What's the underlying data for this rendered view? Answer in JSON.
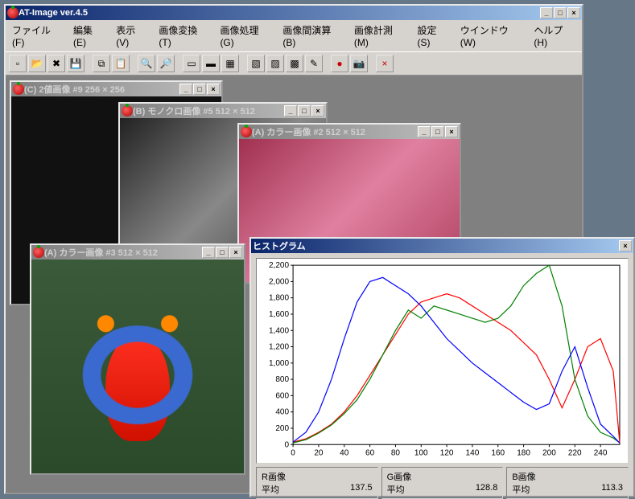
{
  "app": {
    "title": "AT-Image ver.4.5",
    "menu": [
      {
        "label": "ファイル(F)"
      },
      {
        "label": "編集(E)"
      },
      {
        "label": "表示(V)"
      },
      {
        "label": "画像変換(T)"
      },
      {
        "label": "画像処理(G)"
      },
      {
        "label": "画像間演算(B)"
      },
      {
        "label": "画像計測(M)"
      },
      {
        "label": "設定(S)"
      },
      {
        "label": "ウインドウ(W)"
      },
      {
        "label": "ヘルプ(H)"
      }
    ]
  },
  "child_windows": {
    "c": {
      "title": "(C) 2値画像 #9  256 × 256"
    },
    "b": {
      "title": "(B) モノクロ画像 #5  512 × 512"
    },
    "a2": {
      "title": "(A) カラー画像 #2  512 × 512"
    },
    "a3": {
      "title": "(A) カラー画像 #3  512 × 512"
    }
  },
  "histogram": {
    "title": "ヒストグラム",
    "stats": {
      "r": {
        "label": "R画像",
        "mean_label": "平均",
        "mean": "137.5"
      },
      "g": {
        "label": "G画像",
        "mean_label": "平均",
        "mean": "128.8"
      },
      "b": {
        "label": "B画像",
        "mean_label": "平均",
        "mean": "113.3"
      }
    }
  },
  "chart_data": {
    "type": "line",
    "title": "",
    "xlabel": "",
    "ylabel": "",
    "xlim": [
      0,
      255
    ],
    "ylim": [
      0,
      2200
    ],
    "x_ticks": [
      0,
      20,
      40,
      60,
      80,
      100,
      120,
      140,
      160,
      180,
      200,
      220,
      240
    ],
    "y_ticks": [
      0,
      200,
      400,
      600,
      800,
      1000,
      1200,
      1400,
      1600,
      1800,
      2000,
      2200
    ],
    "series": [
      {
        "name": "R",
        "color": "#ff0000",
        "x": [
          0,
          10,
          20,
          30,
          40,
          50,
          60,
          70,
          80,
          90,
          100,
          110,
          120,
          130,
          140,
          150,
          160,
          170,
          180,
          190,
          200,
          210,
          220,
          230,
          240,
          250,
          255
        ],
        "values": [
          30,
          70,
          150,
          250,
          400,
          600,
          850,
          1100,
          1350,
          1600,
          1750,
          1800,
          1850,
          1800,
          1700,
          1600,
          1500,
          1400,
          1250,
          1100,
          800,
          450,
          800,
          1200,
          1300,
          900,
          20
        ]
      },
      {
        "name": "G",
        "color": "#008000",
        "x": [
          0,
          10,
          20,
          30,
          40,
          50,
          60,
          70,
          80,
          90,
          100,
          110,
          120,
          130,
          140,
          150,
          160,
          170,
          180,
          190,
          200,
          210,
          220,
          230,
          240,
          250,
          255
        ],
        "values": [
          20,
          60,
          140,
          240,
          380,
          550,
          800,
          1100,
          1400,
          1650,
          1550,
          1700,
          1650,
          1600,
          1550,
          1500,
          1550,
          1700,
          1950,
          2100,
          2200,
          1700,
          800,
          350,
          150,
          80,
          20
        ]
      },
      {
        "name": "B",
        "color": "#0000ff",
        "x": [
          0,
          10,
          20,
          30,
          40,
          50,
          60,
          70,
          80,
          90,
          100,
          110,
          120,
          130,
          140,
          150,
          160,
          170,
          180,
          190,
          200,
          210,
          220,
          230,
          240,
          250,
          255
        ],
        "values": [
          30,
          150,
          400,
          800,
          1300,
          1750,
          2000,
          2050,
          1950,
          1850,
          1700,
          1500,
          1300,
          1150,
          1000,
          880,
          760,
          640,
          520,
          430,
          500,
          900,
          1200,
          700,
          250,
          100,
          20
        ]
      }
    ]
  }
}
